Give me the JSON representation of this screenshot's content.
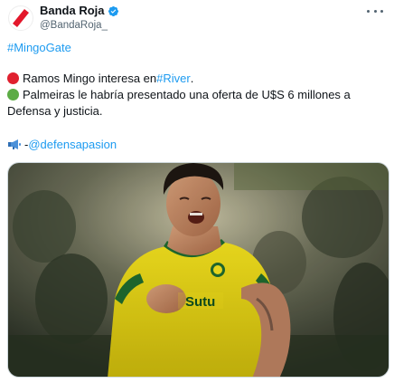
{
  "author": {
    "display_name": "Banda Roja",
    "handle": "@BandaRoja_",
    "avatar_icon": "red-stripe-logo-icon",
    "verified_icon": "verified-badge-icon",
    "accent_color": "#1d9bf0"
  },
  "tweet": {
    "hashtag": "#MingoGate",
    "line1_prefix": "Ramos Mingo interesa en ",
    "line1_link": "#River",
    "line1_suffix": ".",
    "line2": "Palmeiras le habría presentado una oferta de U$S 6 millones a",
    "line3": "Defensa y justicia.",
    "line4_prefix": " - ",
    "line4_link": "@defensapasion",
    "line1_icon": "red-circle-icon",
    "line2_icon": "green-circle-icon",
    "line4_icon": "megaphone-icon"
  },
  "media": {
    "jersey_text": "Sutu"
  }
}
